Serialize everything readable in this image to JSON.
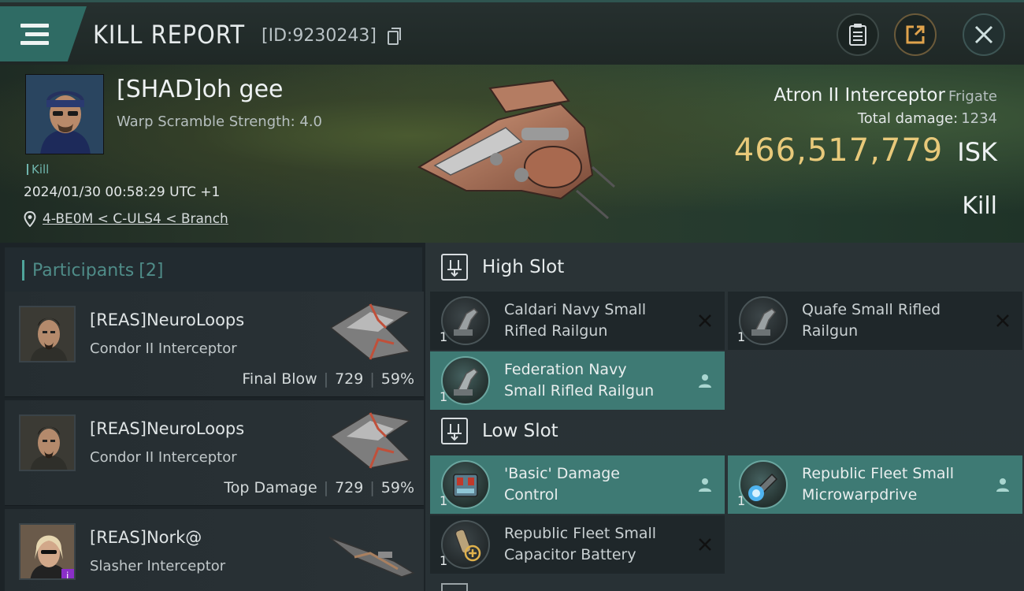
{
  "header": {
    "title": "KILL REPORT",
    "report_id": "[ID:9230243]",
    "icons": [
      "menu-icon",
      "copy-icon",
      "clipboard-icon",
      "share-icon",
      "close-icon"
    ]
  },
  "victim": {
    "name": "[SHAD]oh gee",
    "subtitle": "Warp Scramble Strength: 4.0",
    "tag": "Kill",
    "datetime": "2024/01/30 00:58:29 UTC +1",
    "location": "4-BE0M < C-ULS4 < Branch",
    "ship_name": "Atron II Interceptor",
    "ship_class": "Frigate",
    "total_damage_label": "Total damage:",
    "total_damage": "1234",
    "isk_value": "466,517,779",
    "isk_unit": "ISK",
    "result": "Kill"
  },
  "participants": {
    "label": "Participants",
    "count": "[2]",
    "rows": [
      {
        "name": "[REAS]NeuroLoops",
        "ship": "Condor II Interceptor",
        "role": "Final Blow",
        "damage": "729",
        "percent": "59%"
      },
      {
        "name": "[REAS]NeuroLoops",
        "ship": "Condor II Interceptor",
        "role": "Top Damage",
        "damage": "729",
        "percent": "59%"
      },
      {
        "name": "[REAS]Nork@",
        "ship": "Slasher Interceptor",
        "role": "",
        "damage": "",
        "percent": ""
      }
    ]
  },
  "fitting": {
    "high_slot_label": "High Slot",
    "low_slot_label": "Low Slot",
    "high": [
      {
        "qty": "1",
        "name_line1": "Caldari Navy Small",
        "name_line2": "Rifled Railgun",
        "state": "destroyed"
      },
      {
        "qty": "1",
        "name_line1": "Quafe Small Rifled",
        "name_line2": "Railgun",
        "state": "destroyed"
      },
      {
        "qty": "1",
        "name_line1": "Federation Navy",
        "name_line2": "Small Rifled Railgun",
        "state": "dropped"
      }
    ],
    "low": [
      {
        "qty": "1",
        "name_line1": "'Basic' Damage",
        "name_line2": "Control",
        "state": "dropped"
      },
      {
        "qty": "1",
        "name_line1": "Republic Fleet Small",
        "name_line2": "Microwarpdrive",
        "state": "dropped"
      },
      {
        "qty": "1",
        "name_line1": "Republic Fleet Small",
        "name_line2": "Capacitor Battery",
        "state": "destroyed"
      }
    ]
  },
  "colors": {
    "accent": "#3e7a74",
    "isk": "#e8c97a",
    "panel": "#1c2327"
  }
}
